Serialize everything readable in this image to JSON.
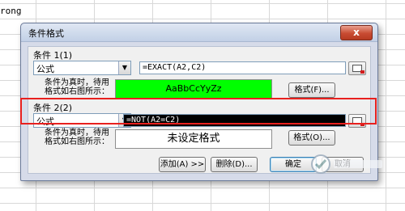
{
  "sheet": {
    "cell_text": "rong"
  },
  "dialog": {
    "title": "条件格式",
    "close_glyph": "x",
    "condition1": {
      "label": "条件 1(1)",
      "type": "公式",
      "formula": "=EXACT(A2,C2)",
      "preview_label_line1": "条件为真时，待用",
      "preview_label_line2": "格式如右图所示：",
      "preview_text": "AaBbCcYyZz",
      "preview_color": "#00ff00",
      "format_button": "格式(F)..."
    },
    "condition2": {
      "label": "条件 2(2)",
      "type": "公式",
      "formula": "=NOT(A2=C2)",
      "preview_label_line1": "条件为真时，待用",
      "preview_label_line2": "格式如右图所示：",
      "preview_text": "未设定格式",
      "format_button": "格式(O)..."
    },
    "buttons": {
      "add": "添加(A) >>",
      "delete": "删除(D)...",
      "ok": "确定",
      "cancel": "取消"
    }
  },
  "colors": {
    "highlight": "#e8201e",
    "dialog_bg": "#f0f0f0"
  }
}
